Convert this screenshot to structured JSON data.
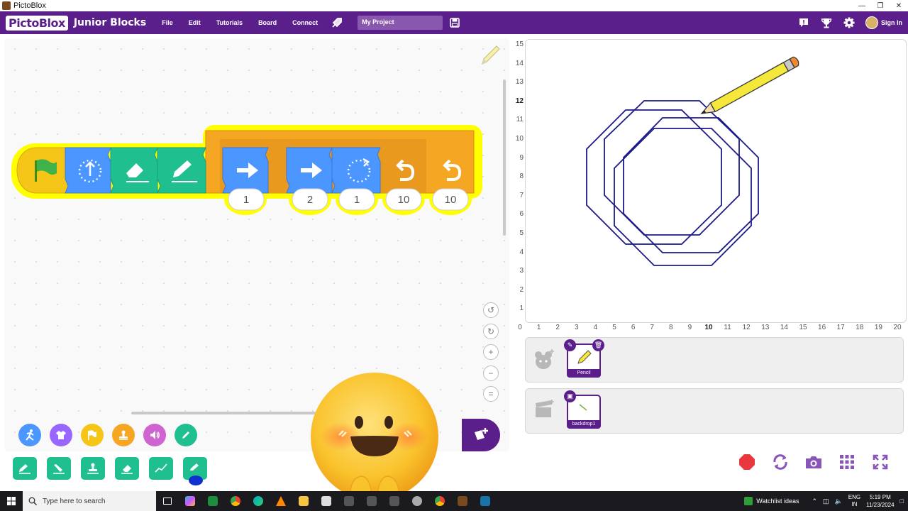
{
  "window": {
    "title": "PictoBlox"
  },
  "menubar": {
    "logo": "PictoBlox",
    "mode": "Junior Blocks",
    "items": [
      "File",
      "Edit",
      "Tutorials",
      "Board",
      "Connect"
    ],
    "project_name": "My Project",
    "signin": "Sign In"
  },
  "script": {
    "inputs": [
      "1",
      "2",
      "1",
      "10",
      "10"
    ],
    "colors": {
      "event": "#f5c518",
      "motion": "#4c97ff",
      "pen": "#1fbf8f",
      "control": "#f5a623",
      "glow": "#ffff00"
    }
  },
  "palette": {
    "categories": [
      {
        "name": "motion",
        "icon": "running-icon",
        "color": "#4c97ff"
      },
      {
        "name": "looks",
        "icon": "shirt-icon",
        "color": "#9966ff"
      },
      {
        "name": "events",
        "icon": "flag-icon",
        "color": "#f5c518"
      },
      {
        "name": "control",
        "icon": "stamp-icon",
        "color": "#f5a623"
      },
      {
        "name": "sound",
        "icon": "speaker-icon",
        "color": "#cf63cf"
      },
      {
        "name": "pen",
        "icon": "pen-icon",
        "color": "#1fbf8f"
      }
    ]
  },
  "stage": {
    "y_labels": [
      "15",
      "14",
      "13",
      "12",
      "11",
      "10",
      "9",
      "8",
      "7",
      "6",
      "5",
      "4",
      "3",
      "2",
      "1"
    ],
    "x_labels": [
      "0",
      "1",
      "2",
      "3",
      "4",
      "5",
      "6",
      "7",
      "8",
      "9",
      "10",
      "11",
      "12",
      "13",
      "14",
      "15",
      "16",
      "17",
      "18",
      "19",
      "20"
    ],
    "bold_y": "12",
    "bold_x": "10",
    "drawing_color": "#1a1a8c"
  },
  "sprites": {
    "items": [
      {
        "name": "Pencil"
      }
    ]
  },
  "backdrops": {
    "items": [
      {
        "name": "backdrop1"
      }
    ]
  },
  "taskbar": {
    "search_placeholder": "Type here to search",
    "weather": "Watchlist ideas",
    "lang_top": "ENG",
    "lang_bottom": "IN",
    "time": "5:19 PM",
    "date": "11/23/2024"
  }
}
